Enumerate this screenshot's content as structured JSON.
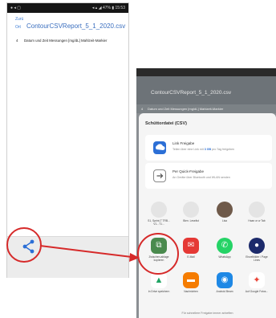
{
  "left_phone": {
    "status_left": "●  ◂  ▢",
    "status_right": "◂  ▴  ◢ 47% ▮ 15:53",
    "back_label": "Zurü",
    "tag_label": "Ort",
    "file_title": "ContourCSVReport_5_1_2020.csv",
    "row_number": "4",
    "row_text": "Datum und Zeit Messungen [mg/dL] Mahlzeit-Markier"
  },
  "right_phone": {
    "file_title": "ContourCSVReport_5_1_2020.csv",
    "row_number": "4",
    "row_text": "Datum und Zeit Messungen [mg/dL] Mahlzeit-Markier",
    "sheet_title": "Schüttordatei (CSV)",
    "card1": {
      "title": "Link Freigabe",
      "sub_pre": "Teilen über eine Link mit ",
      "sub_bold": "3 GB",
      "sub_post": " pro Tag freigeben"
    },
    "card2": {
      "title": "Per Quick-Freigabe",
      "sub": "An Geräte über Bluetooth und WLAN senden"
    },
    "contacts": [
      {
        "label": "S1, Sprint-T TRB... V1...T1...",
        "color": "#e4e4e4"
      },
      {
        "label": "Bien. Leselist",
        "color": "#e4e4e4"
      },
      {
        "label": "Lisa",
        "color": "#6f5a4a"
      },
      {
        "label": "Haan or w Tab",
        "color": "#e4e4e4"
      }
    ],
    "apps_row1": [
      {
        "label": "Zwischen-ablage kopieren",
        "color": "#4a8a4e",
        "glyph": "⧉"
      },
      {
        "label": "E-Mail",
        "color": "#e53935",
        "glyph": "✉"
      },
      {
        "label": "WhatsApp",
        "color": "#25d366",
        "glyph": "✆"
      },
      {
        "label": "Einzelbilder / Page Lines",
        "color": "#1c2a6b",
        "glyph": "●"
      }
    ],
    "apps_row2": [
      {
        "label": "In Drive speichern",
        "color": "#ffffff",
        "glyph": "▲"
      },
      {
        "label": "Nachrichten",
        "color": "#f57c00",
        "glyph": "▬"
      },
      {
        "label": "Android Beam",
        "color": "#1e88e5",
        "glyph": "◉"
      },
      {
        "label": "Auf Google Fotos...",
        "color": "#ffffff",
        "glyph": "✦"
      }
    ],
    "footer": "Für schnellere Freigabe immer anheften"
  },
  "colors": {
    "accent_red": "#d62a2a",
    "share_blue": "#2c6fd6"
  }
}
